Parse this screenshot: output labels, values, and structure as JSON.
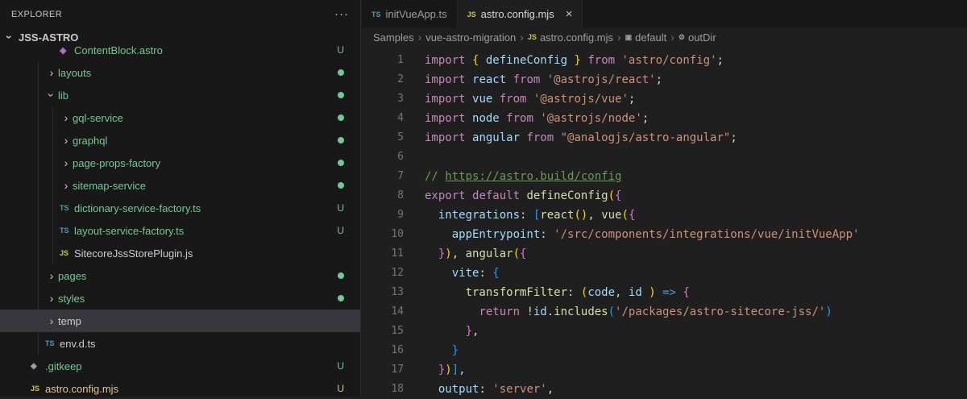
{
  "colors": {
    "sidebar_bg": "#181818",
    "editor_bg": "#1F1F1F",
    "selected_row_bg": "#37373D",
    "untracked_green": "#73C991",
    "modified_yellow": "#E2C08D",
    "ts_icon_blue": "#519ABA",
    "js_icon_yellow": "#CBCB41"
  },
  "sidebar": {
    "header": "EXPLORER",
    "more_label": "···",
    "section": "JSS-ASTRO",
    "items": [
      {
        "label": "ContentBlock.astro",
        "kind": "file",
        "icon": "astro",
        "indent": 3,
        "git": "u",
        "badge": "U",
        "clipped": true
      },
      {
        "label": "layouts",
        "kind": "folder",
        "open": false,
        "indent": 2,
        "git": "u",
        "badge": "dot"
      },
      {
        "label": "lib",
        "kind": "folder",
        "open": true,
        "indent": 2,
        "git": "u",
        "badge": "dot"
      },
      {
        "label": "gql-service",
        "kind": "folder",
        "open": false,
        "indent": 3,
        "git": "u",
        "badge": "dot"
      },
      {
        "label": "graphql",
        "kind": "folder",
        "open": false,
        "indent": 3,
        "git": "u",
        "badge": "dot"
      },
      {
        "label": "page-props-factory",
        "kind": "folder",
        "open": false,
        "indent": 3,
        "git": "u",
        "badge": "dot"
      },
      {
        "label": "sitemap-service",
        "kind": "folder",
        "open": false,
        "indent": 3,
        "git": "u",
        "badge": "dot"
      },
      {
        "label": "dictionary-service-factory.ts",
        "kind": "file",
        "icon": "ts",
        "indent": 3,
        "git": "u",
        "badge": "U"
      },
      {
        "label": "layout-service-factory.ts",
        "kind": "file",
        "icon": "ts",
        "indent": 3,
        "git": "u",
        "badge": "U"
      },
      {
        "label": "SitecoreJssStorePlugin.js",
        "kind": "file",
        "icon": "js",
        "indent": 3
      },
      {
        "label": "pages",
        "kind": "folder",
        "open": false,
        "indent": 2,
        "git": "u",
        "badge": "dot"
      },
      {
        "label": "styles",
        "kind": "folder",
        "open": false,
        "indent": 2,
        "git": "u",
        "badge": "dot"
      },
      {
        "label": "temp",
        "kind": "folder",
        "open": false,
        "indent": 2,
        "selected": true
      },
      {
        "label": "env.d.ts",
        "kind": "file",
        "icon": "ts",
        "indent": 2
      },
      {
        "label": ".gitkeep",
        "kind": "file",
        "icon": "git",
        "indent": 1,
        "git": "u",
        "badge": "U"
      },
      {
        "label": "astro.config.mjs",
        "kind": "file",
        "icon": "js",
        "indent": 1,
        "git": "m",
        "badge": "U"
      }
    ]
  },
  "tabs": [
    {
      "label": "initVueApp.ts",
      "icon": "ts",
      "active": false
    },
    {
      "label": "astro.config.mjs",
      "icon": "js",
      "active": true,
      "close": "×"
    }
  ],
  "breadcrumbs": [
    {
      "label": "Samples"
    },
    {
      "label": "vue-astro-migration"
    },
    {
      "label": "astro.config.mjs",
      "icon": "js"
    },
    {
      "label": "default",
      "icon": "symbol"
    },
    {
      "label": "outDir",
      "icon": "wrench"
    }
  ],
  "editor": {
    "lines": [
      {
        "n": 1,
        "tokens": [
          {
            "t": "import ",
            "c": "kw"
          },
          {
            "t": "{ ",
            "c": "b1"
          },
          {
            "t": "defineConfig",
            "c": "id"
          },
          {
            "t": " ",
            "c": "pun"
          },
          {
            "t": "}",
            "c": "b1"
          },
          {
            "t": " ",
            "c": "pun"
          },
          {
            "t": "from ",
            "c": "kw"
          },
          {
            "t": "'astro/config'",
            "c": "str"
          },
          {
            "t": ";",
            "c": "pun"
          }
        ]
      },
      {
        "n": 2,
        "tokens": [
          {
            "t": "import ",
            "c": "kw"
          },
          {
            "t": "react ",
            "c": "id"
          },
          {
            "t": "from ",
            "c": "kw"
          },
          {
            "t": "'@astrojs/react'",
            "c": "str"
          },
          {
            "t": ";",
            "c": "pun"
          }
        ]
      },
      {
        "n": 3,
        "tokens": [
          {
            "t": "import ",
            "c": "kw"
          },
          {
            "t": "vue ",
            "c": "id"
          },
          {
            "t": "from ",
            "c": "kw"
          },
          {
            "t": "'@astrojs/vue'",
            "c": "str"
          },
          {
            "t": ";",
            "c": "pun"
          }
        ]
      },
      {
        "n": 4,
        "tokens": [
          {
            "t": "import ",
            "c": "kw"
          },
          {
            "t": "node ",
            "c": "id"
          },
          {
            "t": "from ",
            "c": "kw"
          },
          {
            "t": "'@astrojs/node'",
            "c": "str"
          },
          {
            "t": ";",
            "c": "pun"
          }
        ]
      },
      {
        "n": 5,
        "tokens": [
          {
            "t": "import ",
            "c": "kw"
          },
          {
            "t": "angular ",
            "c": "id"
          },
          {
            "t": "from ",
            "c": "kw"
          },
          {
            "t": "\"@analogjs/astro-angular\"",
            "c": "str"
          },
          {
            "t": ";",
            "c": "pun"
          }
        ]
      },
      {
        "n": 6,
        "tokens": []
      },
      {
        "n": 7,
        "tokens": [
          {
            "t": "// ",
            "c": "cmt"
          },
          {
            "t": "https://astro.build/config",
            "c": "link"
          }
        ]
      },
      {
        "n": 8,
        "tokens": [
          {
            "t": "export ",
            "c": "kw"
          },
          {
            "t": "default ",
            "c": "kw"
          },
          {
            "t": "defineConfig",
            "c": "fn"
          },
          {
            "t": "(",
            "c": "b1"
          },
          {
            "t": "{",
            "c": "b2"
          }
        ]
      },
      {
        "n": 9,
        "tokens": [
          {
            "t": "  ",
            "c": "pun"
          },
          {
            "t": "integrations",
            "c": "id"
          },
          {
            "t": ": ",
            "c": "pun"
          },
          {
            "t": "[",
            "c": "b3"
          },
          {
            "t": "react",
            "c": "fn"
          },
          {
            "t": "(",
            "c": "b1"
          },
          {
            "t": ")",
            "c": "b1"
          },
          {
            "t": ", ",
            "c": "pun"
          },
          {
            "t": "vue",
            "c": "fn"
          },
          {
            "t": "(",
            "c": "b1"
          },
          {
            "t": "{",
            "c": "b2"
          }
        ]
      },
      {
        "n": 10,
        "tokens": [
          {
            "t": "    ",
            "c": "pun"
          },
          {
            "t": "appEntrypoint",
            "c": "id"
          },
          {
            "t": ": ",
            "c": "pun"
          },
          {
            "t": "'/src/components/integrations/vue/initVueApp'",
            "c": "str"
          }
        ]
      },
      {
        "n": 11,
        "tokens": [
          {
            "t": "  ",
            "c": "pun"
          },
          {
            "t": "}",
            "c": "b2"
          },
          {
            "t": ")",
            "c": "b1"
          },
          {
            "t": ", ",
            "c": "pun"
          },
          {
            "t": "angular",
            "c": "fn"
          },
          {
            "t": "(",
            "c": "b1"
          },
          {
            "t": "{",
            "c": "b2"
          }
        ]
      },
      {
        "n": 12,
        "tokens": [
          {
            "t": "    ",
            "c": "pun"
          },
          {
            "t": "vite",
            "c": "id"
          },
          {
            "t": ": ",
            "c": "pun"
          },
          {
            "t": "{",
            "c": "b3"
          }
        ]
      },
      {
        "n": 13,
        "tokens": [
          {
            "t": "      ",
            "c": "pun"
          },
          {
            "t": "transformFilter",
            "c": "fn"
          },
          {
            "t": ": ",
            "c": "pun"
          },
          {
            "t": "(",
            "c": "b1"
          },
          {
            "t": "code",
            "c": "id"
          },
          {
            "t": ", ",
            "c": "pun"
          },
          {
            "t": "id ",
            "c": "id"
          },
          {
            "t": ")",
            "c": "b1"
          },
          {
            "t": " ",
            "c": "pun"
          },
          {
            "t": "=>",
            "c": "arrow"
          },
          {
            "t": " ",
            "c": "pun"
          },
          {
            "t": "{",
            "c": "b2"
          }
        ]
      },
      {
        "n": 14,
        "tokens": [
          {
            "t": "        ",
            "c": "pun"
          },
          {
            "t": "return",
            "c": "kw"
          },
          {
            "t": " !",
            "c": "pun"
          },
          {
            "t": "id",
            "c": "id"
          },
          {
            "t": ".",
            "c": "pun"
          },
          {
            "t": "includes",
            "c": "fn"
          },
          {
            "t": "(",
            "c": "b3"
          },
          {
            "t": "'/packages/astro-sitecore-jss/'",
            "c": "str"
          },
          {
            "t": ")",
            "c": "b3"
          }
        ]
      },
      {
        "n": 15,
        "tokens": [
          {
            "t": "      ",
            "c": "pun"
          },
          {
            "t": "}",
            "c": "b2"
          },
          {
            "t": ",",
            "c": "pun"
          }
        ]
      },
      {
        "n": 16,
        "tokens": [
          {
            "t": "    ",
            "c": "pun"
          },
          {
            "t": "}",
            "c": "b3"
          }
        ]
      },
      {
        "n": 17,
        "tokens": [
          {
            "t": "  ",
            "c": "pun"
          },
          {
            "t": "}",
            "c": "b2"
          },
          {
            "t": ")",
            "c": "b1"
          },
          {
            "t": "]",
            "c": "b3"
          },
          {
            "t": ",",
            "c": "pun"
          }
        ]
      },
      {
        "n": 18,
        "tokens": [
          {
            "t": "  ",
            "c": "pun"
          },
          {
            "t": "output",
            "c": "id"
          },
          {
            "t": ": ",
            "c": "pun"
          },
          {
            "t": "'server'",
            "c": "str"
          },
          {
            "t": ",",
            "c": "pun"
          }
        ]
      }
    ]
  }
}
